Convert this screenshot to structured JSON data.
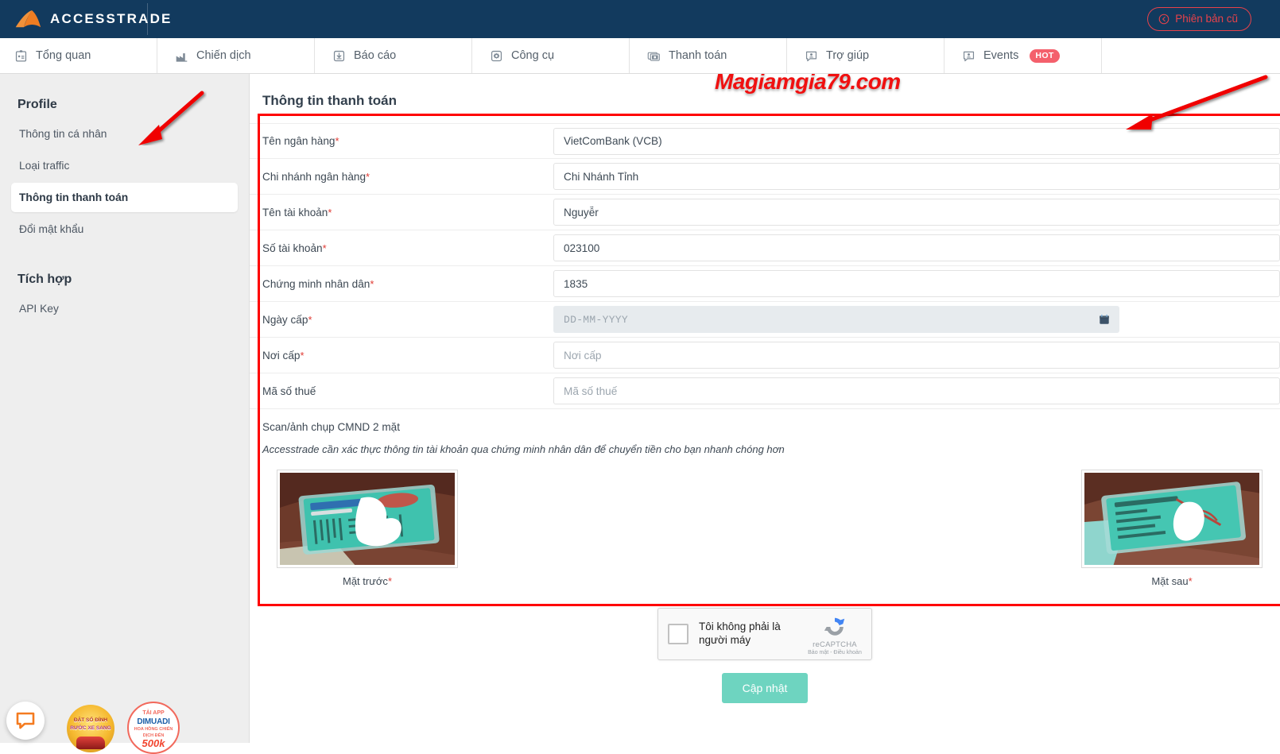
{
  "brand": {
    "name": "ACCESSTRADE",
    "logo_icon": "accesstrade-logo-icon"
  },
  "topbar": {
    "old_version_label": "Phiên bản cũ",
    "old_version_icon": "back-circle-icon",
    "accent_color": "#e8424a",
    "background_color": "#123a5e"
  },
  "nav": {
    "tabs": [
      {
        "label": "Tổng quan",
        "icon": "dashboard-icon"
      },
      {
        "label": "Chiến dịch",
        "icon": "factory-icon"
      },
      {
        "label": "Báo cáo",
        "icon": "download-report-icon"
      },
      {
        "label": "Công cụ",
        "icon": "gear-icon"
      },
      {
        "label": "Thanh toán",
        "icon": "banknote-icon"
      },
      {
        "label": "Trợ giúp",
        "icon": "help-chat-icon"
      },
      {
        "label": "Events",
        "icon": "events-chat-icon",
        "badge": "HOT",
        "badge_color": "#f4606c"
      }
    ]
  },
  "sidebar": {
    "groups": [
      {
        "title": "Profile",
        "items": [
          {
            "label": "Thông tin cá nhân",
            "active": false
          },
          {
            "label": "Loại traffic",
            "active": false
          },
          {
            "label": "Thông tin thanh toán",
            "active": true
          },
          {
            "label": "Đổi mật khẩu",
            "active": false
          }
        ]
      },
      {
        "title": "Tích hợp",
        "items": [
          {
            "label": "API Key",
            "active": false
          }
        ]
      }
    ]
  },
  "main": {
    "panel_title": "Thông tin thanh toán",
    "fields": [
      {
        "label": "Tên ngân hàng",
        "required": true,
        "value": "VietComBank (VCB)",
        "placeholder": ""
      },
      {
        "label": "Chi nhánh ngân hàng",
        "required": true,
        "value": "Chi Nhánh Tỉnh",
        "placeholder": ""
      },
      {
        "label": "Tên tài khoản",
        "required": true,
        "value": "Nguyễr",
        "placeholder": ""
      },
      {
        "label": "Số tài khoản",
        "required": true,
        "value": "023100",
        "placeholder": ""
      },
      {
        "label": "Chứng minh nhân dân",
        "required": true,
        "value": "1835",
        "placeholder": ""
      }
    ],
    "date_field": {
      "label": "Ngày cấp",
      "required": true,
      "value": "",
      "placeholder": "DD-MM-YYYY",
      "icon": "calendar-icon"
    },
    "fields_after": [
      {
        "label": "Nơi cấp",
        "required": true,
        "value": "",
        "placeholder": "Nơi cấp"
      },
      {
        "label": "Mã số thuế",
        "required": false,
        "value": "",
        "placeholder": "Mã số thuế"
      }
    ],
    "scan_heading": "Scan/ảnh chụp CMND 2 mặt",
    "scan_note": "Accesstrade cần xác thực thông tin tài khoản qua chứng minh nhân dân để chuyển tiền cho bạn nhanh chóng hơn",
    "cards": [
      {
        "caption": "Mặt trước",
        "required": true,
        "image": "id-card-front-photo"
      },
      {
        "caption": "Mặt sau",
        "required": true,
        "image": "id-card-back-photo"
      }
    ],
    "captcha": {
      "label": "Tôi không phải là người máy",
      "brand": "reCAPTCHA",
      "links": "Bảo mật - Điều khoản",
      "logo_icon": "recaptcha-logo-icon"
    },
    "submit_label": "Cập nhật",
    "submit_color": "#6ed4c0"
  },
  "annotations": {
    "watermark": "Magiamgia79.com",
    "watermark_color": "#f01010",
    "box_color": "#ff0000",
    "arrows": [
      "sidebar-arrow",
      "form-arrow"
    ]
  },
  "floating": {
    "chat_icon": "chat-bubble-icon",
    "promo1": {
      "line1": "ĐẶT SỐ ĐÍNH",
      "line2": "RƯỚC XE SANG"
    },
    "promo2": {
      "line1": "TẢI APP",
      "line2": "DIMUADI",
      "line3": "HOA HỒNG CHIẾN DỊCH ĐẾN",
      "line4": "500k"
    }
  }
}
